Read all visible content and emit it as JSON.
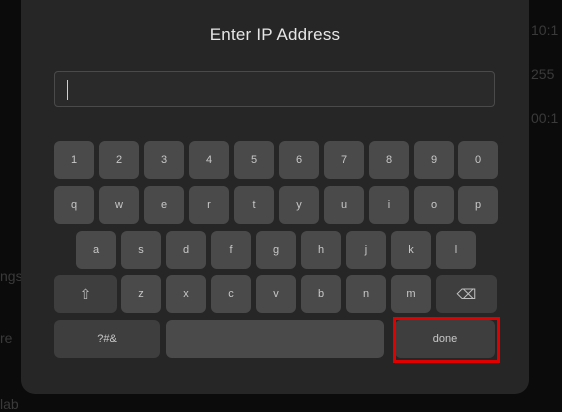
{
  "background": {
    "fragments": [
      "10:1",
      "255",
      "00:1",
      "ngs",
      "re",
      "lab"
    ]
  },
  "dialog": {
    "title": "Enter IP Address",
    "input": {
      "value": ""
    }
  },
  "keyboard": {
    "row1": [
      "1",
      "2",
      "3",
      "4",
      "5",
      "6",
      "7",
      "8",
      "9",
      "0"
    ],
    "row2": [
      "q",
      "w",
      "e",
      "r",
      "t",
      "y",
      "u",
      "i",
      "o",
      "p"
    ],
    "row3": [
      "a",
      "s",
      "d",
      "f",
      "g",
      "h",
      "j",
      "k",
      "l"
    ],
    "row4": [
      "z",
      "x",
      "c",
      "v",
      "b",
      "n",
      "m"
    ],
    "shift_glyph": "⇧",
    "backspace_glyph": "⌫",
    "symbols_label": "?#&",
    "space_label": "",
    "done_label": "done"
  }
}
